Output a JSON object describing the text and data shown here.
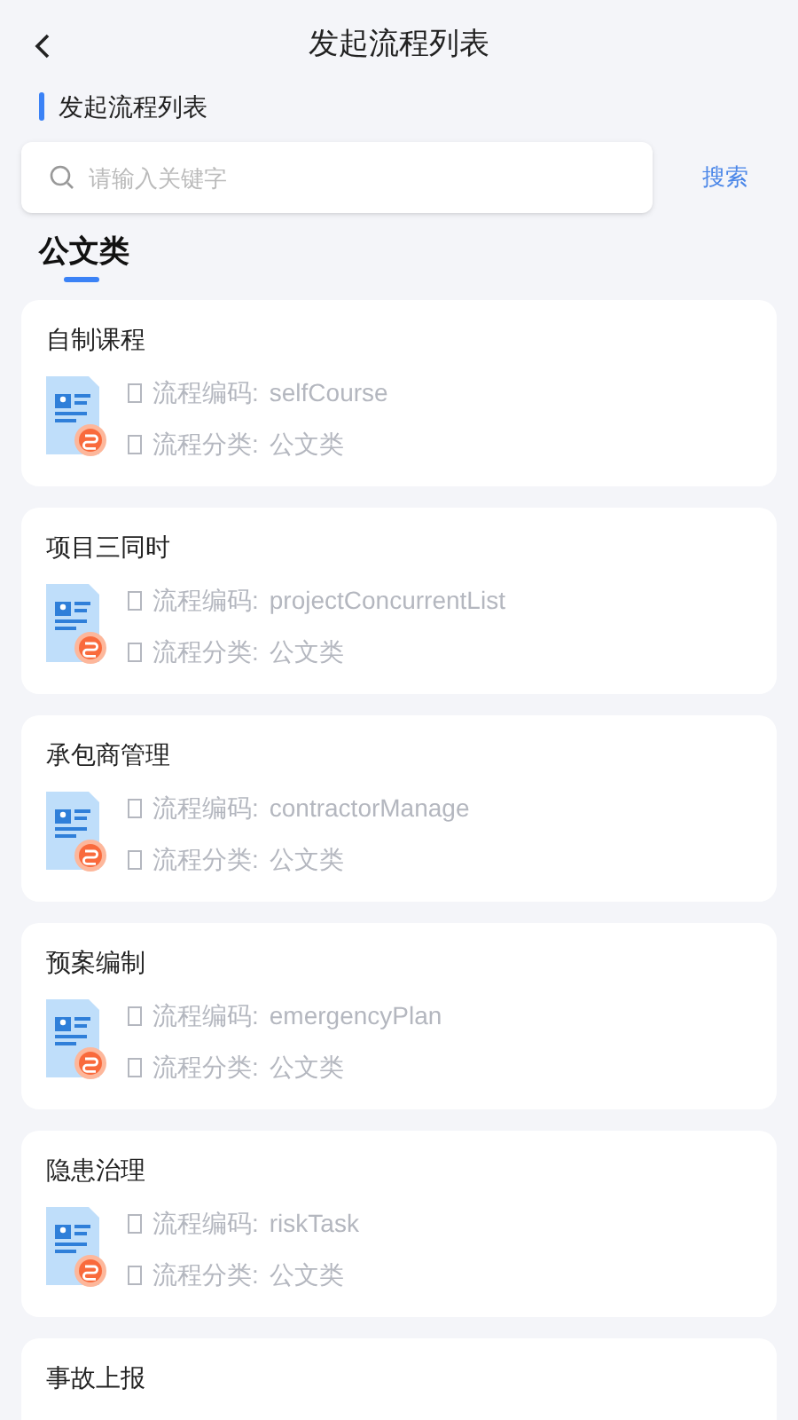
{
  "header": {
    "title": "发起流程列表"
  },
  "section_label": "发起流程列表",
  "search": {
    "placeholder": "请输入关键字",
    "button": "搜索"
  },
  "category_tabs": [
    {
      "label": "公文类",
      "selected": true
    }
  ],
  "processes": [
    {
      "name": "自制课程",
      "code_label": "流程编码:",
      "code": "selfCourse",
      "category_label": "流程分类:",
      "category": "公文类"
    },
    {
      "name": "项目三同时",
      "code_label": "流程编码:",
      "code": "projectConcurrentList",
      "category_label": "流程分类:",
      "category": "公文类"
    },
    {
      "name": "承包商管理",
      "code_label": "流程编码:",
      "code": "contractorManage",
      "category_label": "流程分类:",
      "category": "公文类"
    },
    {
      "name": "预案编制",
      "code_label": "流程编码:",
      "code": "emergencyPlan",
      "category_label": "流程分类:",
      "category": "公文类"
    },
    {
      "name": "隐患治理",
      "code_label": "流程编码:",
      "code": "riskTask",
      "category_label": "流程分类:",
      "category": "公文类"
    },
    {
      "name": "事故上报"
    }
  ]
}
